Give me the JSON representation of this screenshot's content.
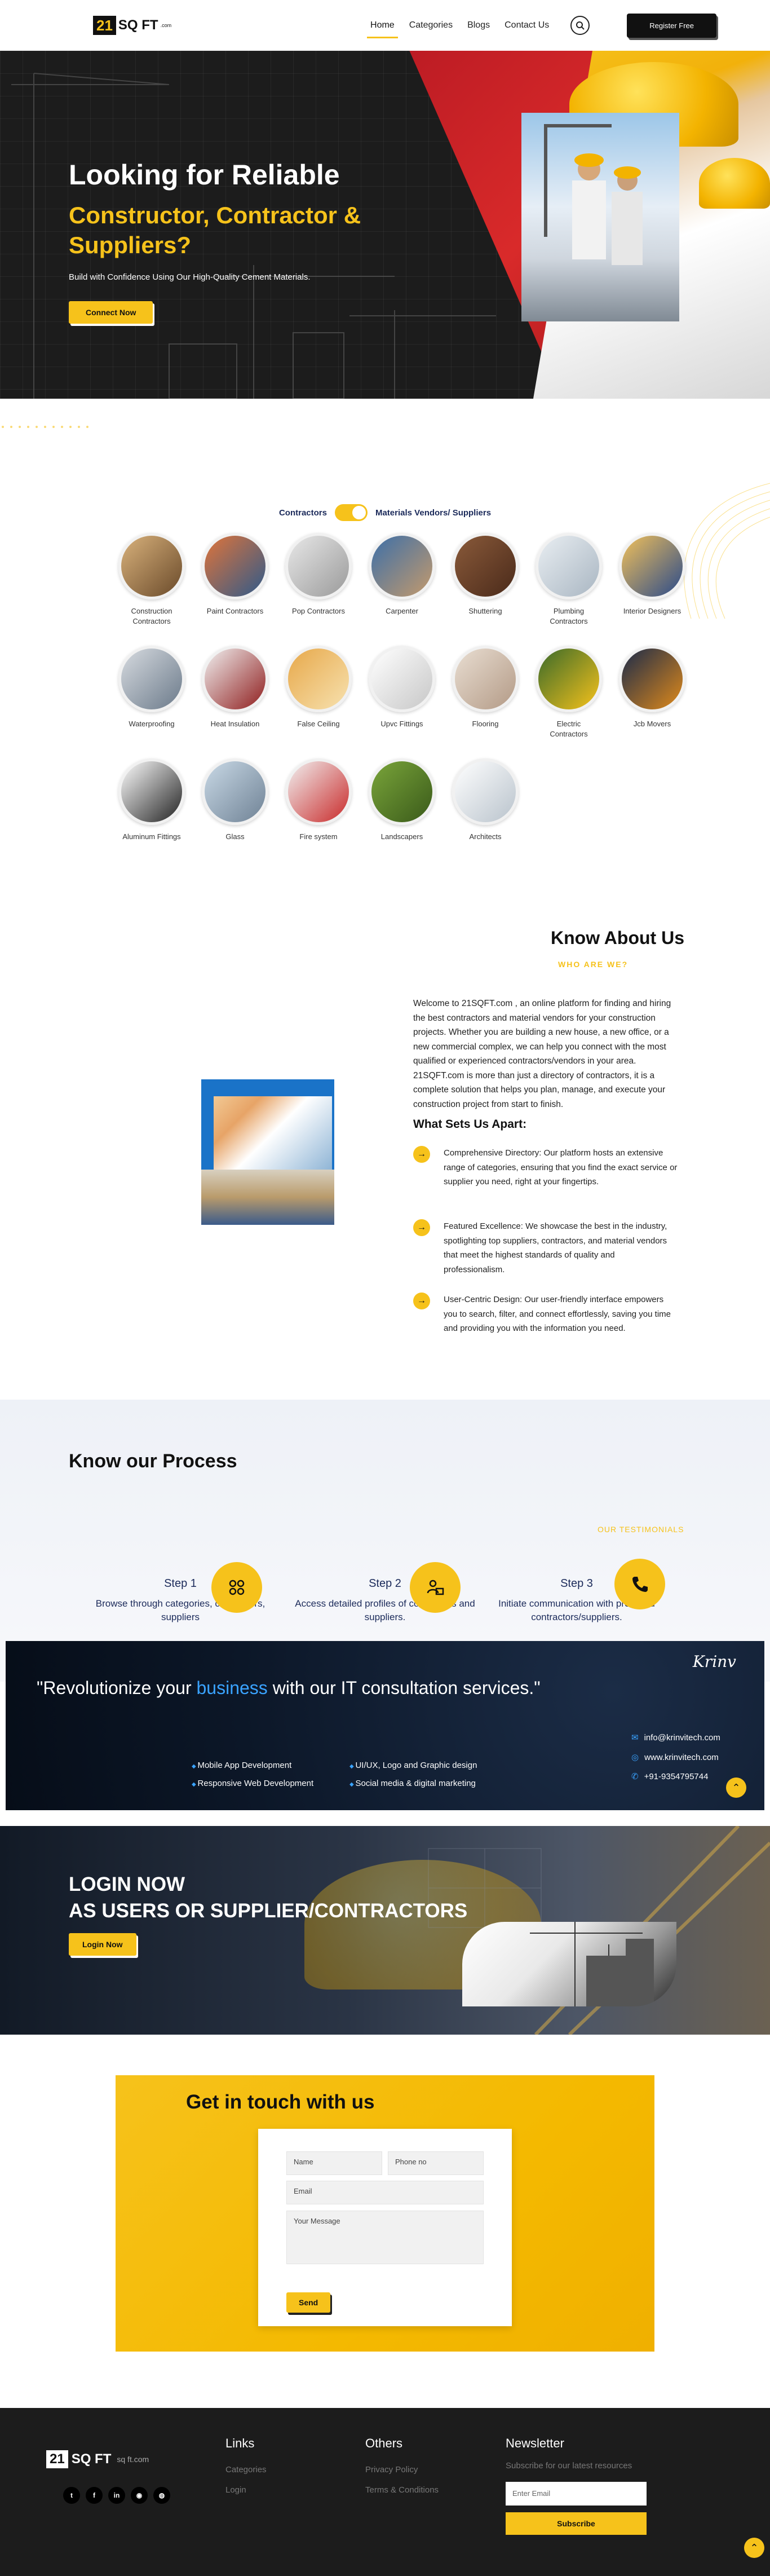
{
  "nav": {
    "logo_num": "21",
    "logo_sq": "SQ FT",
    "logo_com": ".com",
    "links": [
      "Home",
      "Categories",
      "Blogs",
      "Contact Us"
    ],
    "register": "Register Free"
  },
  "hero": {
    "line1": "Looking for Reliable",
    "line2": "Constructor, Contractor & Suppliers?",
    "sub": "Build with Confidence Using Our High-Quality Cement Materials.",
    "cta": "Connect Now"
  },
  "toggle": {
    "left": "Contractors",
    "right": "Materials Vendors/ Suppliers"
  },
  "categories": [
    {
      "name": "Construction Contractors",
      "c1": "#d9b27c",
      "c2": "#6a4a2a"
    },
    {
      "name": "Paint Contractors",
      "c1": "#e0743a",
      "c2": "#2f5a8a"
    },
    {
      "name": "Pop Contractors",
      "c1": "#e8e8e8",
      "c2": "#9a9a9a"
    },
    {
      "name": "Carpenter",
      "c1": "#3c6fa8",
      "c2": "#c49a6c"
    },
    {
      "name": "Shuttering",
      "c1": "#8a5a3a",
      "c2": "#4a2a1a"
    },
    {
      "name": "Plumbing Contractors",
      "c1": "#e9eef2",
      "c2": "#a9b6c2"
    },
    {
      "name": "Interior Designers",
      "c1": "#f2c15a",
      "c2": "#2a4a8a"
    },
    {
      "name": "Waterproofing",
      "c1": "#d7dbe0",
      "c2": "#6b7a8a"
    },
    {
      "name": "Heat Insulation",
      "c1": "#f1f1f1",
      "c2": "#8f1d1d"
    },
    {
      "name": "False Ceiling",
      "c1": "#e7a84a",
      "c2": "#f7e2b0"
    },
    {
      "name": "Upvc Fittings",
      "c1": "#ffffff",
      "c2": "#c7c7c7"
    },
    {
      "name": "Flooring",
      "c1": "#e9ded2",
      "c2": "#b39a86"
    },
    {
      "name": "Electric Contractors",
      "c1": "#3a6a2a",
      "c2": "#f6c21b"
    },
    {
      "name": "Jcb Movers",
      "c1": "#1a2a4a",
      "c2": "#e08a1a"
    },
    {
      "name": "Aluminum Fittings",
      "c1": "#ffffff",
      "c2": "#222222"
    },
    {
      "name": "Glass",
      "c1": "#c9d9e6",
      "c2": "#6f8295"
    },
    {
      "name": "Fire system",
      "c1": "#f1f1f1",
      "c2": "#c92a2a"
    },
    {
      "name": "Landscapers",
      "c1": "#7aa53a",
      "c2": "#3a5a1a"
    },
    {
      "name": "Architects",
      "c1": "#ffffff",
      "c2": "#b9c3cc"
    }
  ],
  "about": {
    "title": "Know About Us",
    "subtitle": "WHO ARE WE?",
    "text": "Welcome to 21SQFT.com , an online platform for finding and hiring the best contractors and material vendors for your construction projects. Whether you are building a new house, a new office, or a new commercial complex, we can help you connect with the most qualified or experienced contractors/vendors in your area. 21SQFT.com is more than just a directory of contractors, it is a complete solution that helps you plan, manage, and execute your construction project from start to finish.",
    "h3": "What Sets Us Apart:",
    "features": [
      "Comprehensive Directory: Our platform hosts an extensive range of categories, ensuring that you find the exact service or supplier you need, right at your fingertips.",
      "Featured Excellence: We showcase the best in the industry, spotlighting top suppliers, contractors, and material vendors that meet the highest standards of quality and professionalism.",
      "User-Centric Design: Our user-friendly interface empowers you to search, filter, and connect effortlessly, saving you time and providing you with the information you need."
    ]
  },
  "process": {
    "title": "Know our Process",
    "testimonials": "OUR TESTIMONIALS",
    "steps": [
      {
        "label": "Step 1",
        "desc": "Browse through categories, contractors, suppliers"
      },
      {
        "label": "Step 2",
        "desc": "Access detailed profiles of contractors and suppliers."
      },
      {
        "label": "Step 3",
        "desc": "Initiate communication with preferred contractors/suppliers."
      }
    ]
  },
  "it_banner": {
    "quote_a": "\"Revolutionize your ",
    "quote_hl": "business",
    "quote_b": " with our IT consultation services.\"",
    "logo": "Krinv",
    "services_col1": [
      "Mobile App Development",
      "Responsive Web Development"
    ],
    "services_col2": [
      "UI/UX, Logo and Graphic design",
      "Social media & digital marketing"
    ],
    "email": "info@krinvitech.com",
    "website": "www.krinvitech.com",
    "phone": "+91-9354795744"
  },
  "login": {
    "line1": "LOGIN NOW",
    "line2": "AS USERS OR SUPPLIER/CONTRACTORS",
    "cta": "Login Now"
  },
  "contact": {
    "title": "Get in touch with us",
    "name_ph": "Name",
    "phone_ph": "Phone no",
    "email_ph": "Email",
    "message_ph": "Your Message",
    "send": "Send"
  },
  "footer": {
    "logo_num": "21",
    "logo_sq": "SQ FT",
    "domain": "sq ft.com",
    "links_title": "Links",
    "links": [
      "Categories",
      "Login"
    ],
    "others_title": "Others",
    "others": [
      "Privacy Policy",
      "Terms & Conditions"
    ],
    "news_title": "Newsletter",
    "news_sub": "Subscribe for our latest resources",
    "email_ph": "Enter Email",
    "subscribe": "Subscribe"
  },
  "colors": {
    "accent": "#f6c21b",
    "dark": "#1c1c1c",
    "navy": "#1b2a5a"
  }
}
